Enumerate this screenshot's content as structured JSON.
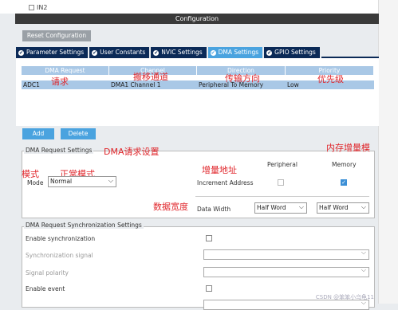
{
  "top": {
    "checkbox_label": "IN2"
  },
  "header": {
    "title": "Configuration"
  },
  "reset_button": "Reset Configuration",
  "tabs": [
    {
      "label": "Parameter Settings",
      "active": false
    },
    {
      "label": "User Constants",
      "active": false
    },
    {
      "label": "NVIC Settings",
      "active": false
    },
    {
      "label": "DMA Settings",
      "active": true
    },
    {
      "label": "GPIO Settings",
      "active": false
    }
  ],
  "dma_table": {
    "columns": [
      "DMA Request",
      "Channel",
      "Direction",
      "Priority"
    ],
    "rows": [
      [
        "ADC1",
        "DMA1 Channel 1",
        "Peripheral To Memory",
        "Low"
      ]
    ]
  },
  "buttons": {
    "add": "Add",
    "delete": "Delete"
  },
  "dma_request_settings": {
    "title": "DMA Request Settings",
    "peripheral_col": "Peripheral",
    "memory_col": "Memory",
    "mode_label": "Mode",
    "mode_value": "Normal",
    "increment_label": "Increment Address",
    "peripheral_increment": false,
    "memory_increment": true,
    "data_width_label": "Data Width",
    "peripheral_width": "Half Word",
    "memory_width": "Half Word"
  },
  "sync_settings": {
    "title": "DMA Request Synchronization Settings",
    "enable_sync": "Enable synchronization",
    "sync_signal": "Synchronization signal",
    "signal_polarity": "Signal polarity",
    "enable_event": "Enable event"
  },
  "annotations": {
    "request": "请求",
    "channel": "搬移通道",
    "direction": "传输方向",
    "priority": "优先级",
    "dma_settings": "DMA请求设置",
    "mem_increment": "内存增量模",
    "mode": "模式",
    "normal_mode": "正常模式",
    "increment_addr": "增量地址",
    "data_width": "数据宽度"
  },
  "watermark": "CSDN @笨笨小乌龟11",
  "colors": {
    "accent": "#4aa3df",
    "tab_dark": "#0b2a57",
    "annotation": "#e0262b"
  }
}
